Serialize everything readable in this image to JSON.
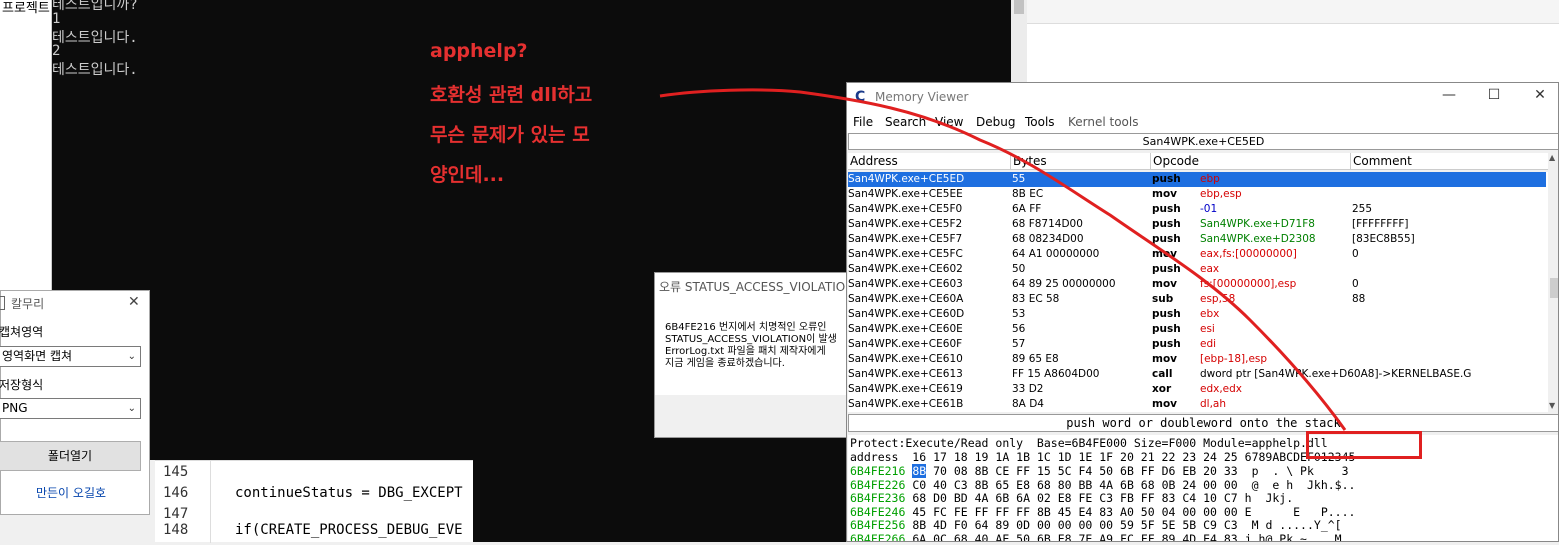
{
  "left_strip": {
    "label": "프로젝트"
  },
  "console": {
    "lines": [
      "테스트입니까?",
      "1",
      "테스트입니다.",
      "2",
      "테스트입니다."
    ]
  },
  "annotation": {
    "lines": [
      "apphelp?",
      "호환성 관련 dll하고",
      "무슨 문제가 있는 모",
      "양인데..."
    ],
    "color": "#e53030"
  },
  "code": {
    "rows": [
      {
        "ln": "145",
        "text": ""
      },
      {
        "ln": "146",
        "text": "continueStatus = DBG_EXCEPT"
      },
      {
        "ln": "147",
        "text": ""
      },
      {
        "ln": "148",
        "text": "if(CREATE_PROCESS_DEBUG_EVE"
      }
    ]
  },
  "capture_tool": {
    "title": "칼무리",
    "region_label": "캡쳐영역",
    "region_value": "영역화면 캡쳐",
    "format_label": "저장형식",
    "format_value": "PNG",
    "folder_button": "폴더열기",
    "link": "만든이 오길호"
  },
  "error_dialog": {
    "title": "오류 STATUS_ACCESS_VIOLATION",
    "body": [
      "6B4FE216 번지에서 치명적인 오류인",
      "STATUS_ACCESS_VIOLATION이 발생",
      "ErrorLog.txt 파일을 패치 제작자에게",
      "지금 게임을 종료하겠습니다."
    ]
  },
  "memory_viewer": {
    "title": "Memory Viewer",
    "menu": [
      "File",
      "Search",
      "View",
      "Debug",
      "Tools",
      "Kernel tools"
    ],
    "address_bar": "San4WPK.exe+CE5ED",
    "columns": [
      "Address",
      "Bytes",
      "Opcode",
      "Comment"
    ],
    "rows": [
      {
        "addr": "San4WPK.exe+CE5ED",
        "bytes": "55",
        "op": "push",
        "arg": "ebp",
        "argc": "red",
        "com": ""
      },
      {
        "addr": "San4WPK.exe+CE5EE",
        "bytes": "8B EC",
        "op": "mov",
        "arg": "ebp,esp",
        "argc": "red",
        "com": ""
      },
      {
        "addr": "San4WPK.exe+CE5F0",
        "bytes": "6A FF",
        "op": "push",
        "arg": "-01",
        "argc": "blue",
        "com": "255"
      },
      {
        "addr": "San4WPK.exe+CE5F2",
        "bytes": "68 F8714D00",
        "op": "push",
        "arg": "San4WPK.exe+D71F8",
        "argc": "green",
        "com": "[FFFFFFFF]"
      },
      {
        "addr": "San4WPK.exe+CE5F7",
        "bytes": "68 08234D00",
        "op": "push",
        "arg": "San4WPK.exe+D2308",
        "argc": "green",
        "com": "[83EC8B55]"
      },
      {
        "addr": "San4WPK.exe+CE5FC",
        "bytes": "64 A1 00000000",
        "op": "mov",
        "arg": "eax,fs:[00000000]",
        "argc": "red",
        "com": "0"
      },
      {
        "addr": "San4WPK.exe+CE602",
        "bytes": "50",
        "op": "push",
        "arg": "eax",
        "argc": "red",
        "com": ""
      },
      {
        "addr": "San4WPK.exe+CE603",
        "bytes": "64 89 25 00000000",
        "op": "mov",
        "arg": "fs:[00000000],esp",
        "argc": "red",
        "com": "0"
      },
      {
        "addr": "San4WPK.exe+CE60A",
        "bytes": "83 EC 58",
        "op": "sub",
        "arg": "esp,58",
        "argc": "red",
        "com": "88"
      },
      {
        "addr": "San4WPK.exe+CE60D",
        "bytes": "53",
        "op": "push",
        "arg": "ebx",
        "argc": "red",
        "com": ""
      },
      {
        "addr": "San4WPK.exe+CE60E",
        "bytes": "56",
        "op": "push",
        "arg": "esi",
        "argc": "red",
        "com": ""
      },
      {
        "addr": "San4WPK.exe+CE60F",
        "bytes": "57",
        "op": "push",
        "arg": "edi",
        "argc": "red",
        "com": ""
      },
      {
        "addr": "San4WPK.exe+CE610",
        "bytes": "89 65 E8",
        "op": "mov",
        "arg": "[ebp-18],esp",
        "argc": "red",
        "com": ""
      },
      {
        "addr": "San4WPK.exe+CE613",
        "bytes": "FF 15 A8604D00",
        "op": "call",
        "arg": "dword ptr [San4WPK.exe+D60A8]->KERNELBASE.G",
        "argc": "black",
        "com": ""
      },
      {
        "addr": "San4WPK.exe+CE619",
        "bytes": "33 D2",
        "op": "xor",
        "arg": "edx,edx",
        "argc": "red",
        "com": ""
      },
      {
        "addr": "San4WPK.exe+CE61B",
        "bytes": "8A D4",
        "op": "mov",
        "arg": "dl,ah",
        "argc": "red",
        "com": ""
      }
    ],
    "status": "push word or doubleword onto the stack",
    "hex_info": "Protect:Execute/Read only  Base=6B4FE000 Size=F000 Module=apphelp.dll",
    "hex_header": "address  16 17 18 19 1A 1B 1C 1D 1E 1F 20 21 22 23 24 25 6789ABCDEF012345",
    "hex_lines": [
      {
        "addr": "6B4FE216",
        "first": "8B",
        "rest": " 70 08 8B CE FF 15 5C F4 50 6B FF D6 EB 20 33",
        "ascii": " p  . \\ Pk    3"
      },
      {
        "addr": "6B4FE226",
        "first": "C0",
        "rest": " 40 C3 8B 65 E8 68 80 BB 4A 6B 68 0B 24 00 00",
        "ascii": " @  e h  Jkh.$.."
      },
      {
        "addr": "6B4FE236",
        "first": "68",
        "rest": " D0 BD 4A 6B 6A 02 E8 FE C3 FB FF 83 C4 10 C7",
        "ascii": "h  Jkj.        "
      },
      {
        "addr": "6B4FE246",
        "first": "45",
        "rest": " FC FE FF FF FF 8B 45 E4 83 A0 50 04 00 00 00",
        "ascii": "E      E   P...."
      },
      {
        "addr": "6B4FE256",
        "first": "8B",
        "rest": " 4D F0 64 89 0D 00 00 00 00 59 5F 5E 5B C9 C3",
        "ascii": " M d .....Y_^[  "
      },
      {
        "addr": "6B4FE266",
        "first": "6A",
        "rest": " 0C 68 40 AE 50 6B E8 7E A9 FC FF 89 4D E4 83",
        "ascii": "j.h@ Pk ~    M  "
      }
    ]
  }
}
